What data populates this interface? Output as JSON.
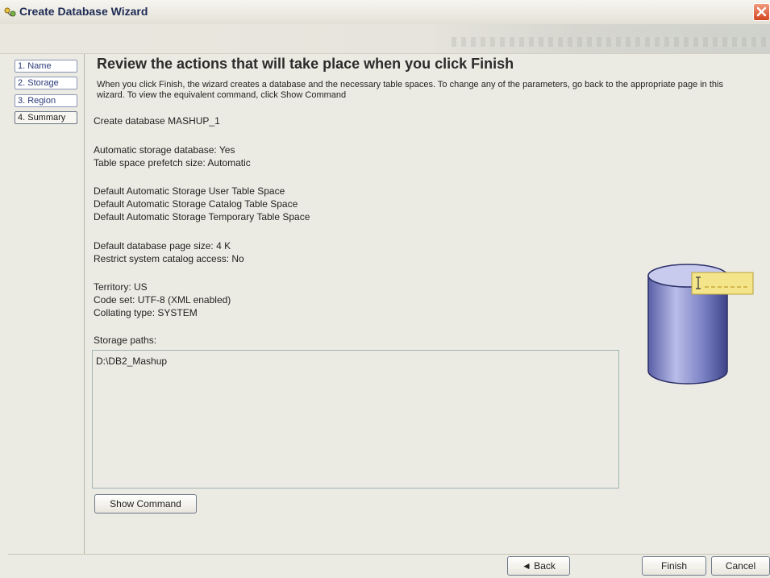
{
  "window": {
    "title": "Create Database Wizard",
    "icons": {
      "title": "wizard-icon",
      "close": "close-icon"
    },
    "colors": {
      "accent": "#1f2b55",
      "close": "#d3451f"
    }
  },
  "nav": {
    "items": [
      {
        "label": "1. Name"
      },
      {
        "label": "2. Storage"
      },
      {
        "label": "3. Region"
      },
      {
        "label": "4. Summary",
        "selected": true
      }
    ]
  },
  "main": {
    "heading": "Review the actions that will take place when you click Finish",
    "description": "When you click Finish, the wizard creates a database and the necessary table spaces. To change any of the parameters, go back to the appropriate page in this wizard. To view the equivalent command, click Show Command",
    "summary_lines": [
      "Create database MASHUP_1",
      "Automatic storage database: Yes",
      "Table space prefetch size: Automatic",
      "Default Automatic Storage User Table Space",
      "Default Automatic Storage Catalog Table Space",
      "Default Automatic Storage Temporary Table Space",
      "Default database page size: 4 K",
      "Restrict system catalog access: No",
      "Territory: US",
      "Code set: UTF-8 (XML enabled)",
      "Collating type: SYSTEM"
    ],
    "storage_paths_label": "Storage paths:",
    "storage_paths": [
      "D:\\DB2_Mashup"
    ],
    "show_command_label": "Show Command"
  },
  "footer": {
    "back_label": "◄ Back",
    "finish_label": "Finish",
    "cancel_label": "Cancel"
  }
}
